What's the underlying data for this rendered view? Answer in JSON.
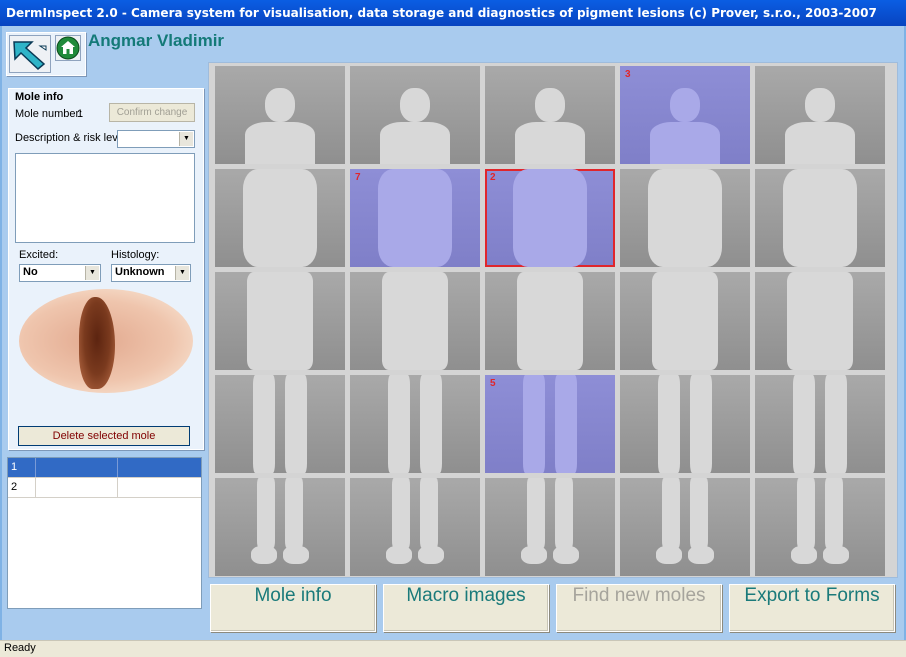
{
  "window": {
    "title": "DermInspect 2.0 - Camera system for visualisation, data storage and diagnostics of pigment lesions (c) Prover, s.r.o., 2003-2007"
  },
  "patient": {
    "name": "Angmar Vladimir"
  },
  "mole_info": {
    "heading": "Mole info",
    "mole_number_label": "Mole number:",
    "mole_number_value": "1",
    "confirm_label": "Confirm change",
    "description_label": "Description & risk level:",
    "description_value": "",
    "risk_value": "",
    "excited_label": "Excited:",
    "excited_value": "No",
    "histology_label": "Histology:",
    "histology_value": "Unknown",
    "delete_label": "Delete selected mole"
  },
  "mole_list": {
    "rows": [
      {
        "id": "1",
        "col2": "",
        "col3": "",
        "selected": true
      },
      {
        "id": "2",
        "col2": "",
        "col3": "",
        "selected": false
      }
    ]
  },
  "body_grid": {
    "cells": [
      {
        "view": "head-front-hands-behind",
        "label": "",
        "highlight": false
      },
      {
        "view": "head-side-right",
        "label": "",
        "highlight": false
      },
      {
        "view": "head-back",
        "label": "",
        "highlight": false
      },
      {
        "view": "head-side-left",
        "label": "3",
        "highlight": true
      },
      {
        "view": "head-top",
        "label": "",
        "highlight": false
      },
      {
        "view": "torso-front",
        "label": "",
        "highlight": false
      },
      {
        "view": "torso-side-right",
        "label": "7",
        "highlight": true
      },
      {
        "view": "torso-back",
        "label": "2",
        "highlight": true,
        "selected": true
      },
      {
        "view": "torso-side-left",
        "label": "",
        "highlight": false
      },
      {
        "view": "torso-front-arms-up",
        "label": "",
        "highlight": false
      },
      {
        "view": "hips-front",
        "label": "",
        "highlight": false
      },
      {
        "view": "hips-side-right",
        "label": "",
        "highlight": false
      },
      {
        "view": "hips-back",
        "label": "",
        "highlight": false
      },
      {
        "view": "hips-side-left",
        "label": "",
        "highlight": false
      },
      {
        "view": "hips-front-legs-apart",
        "label": "",
        "highlight": false
      },
      {
        "view": "legs-front",
        "label": "",
        "highlight": false
      },
      {
        "view": "legs-side-right",
        "label": "",
        "highlight": false
      },
      {
        "view": "legs-back",
        "label": "5",
        "highlight": true
      },
      {
        "view": "legs-side-left",
        "label": "",
        "highlight": false
      },
      {
        "view": "legs-front-apart",
        "label": "",
        "highlight": false
      },
      {
        "view": "feet-front",
        "label": "",
        "highlight": false
      },
      {
        "view": "feet-side-right",
        "label": "",
        "highlight": false
      },
      {
        "view": "feet-back",
        "label": "",
        "highlight": false
      },
      {
        "view": "feet-side-left",
        "label": "",
        "highlight": false
      },
      {
        "view": "feet-soles",
        "label": "",
        "highlight": false
      }
    ]
  },
  "buttons": {
    "mole_info": "Mole info",
    "macro_images": "Macro images",
    "find_new_moles": "Find new moles",
    "export_to_forms": "Export to Forms"
  },
  "status": {
    "text": "Ready"
  },
  "icons": {
    "back": "back-arrow-icon",
    "home": "home-icon"
  },
  "colors": {
    "title_bar": "#0a5ee3",
    "highlight": "#8e8ed6",
    "selected_border": "#e0262c",
    "accent_text": "#147a78"
  }
}
